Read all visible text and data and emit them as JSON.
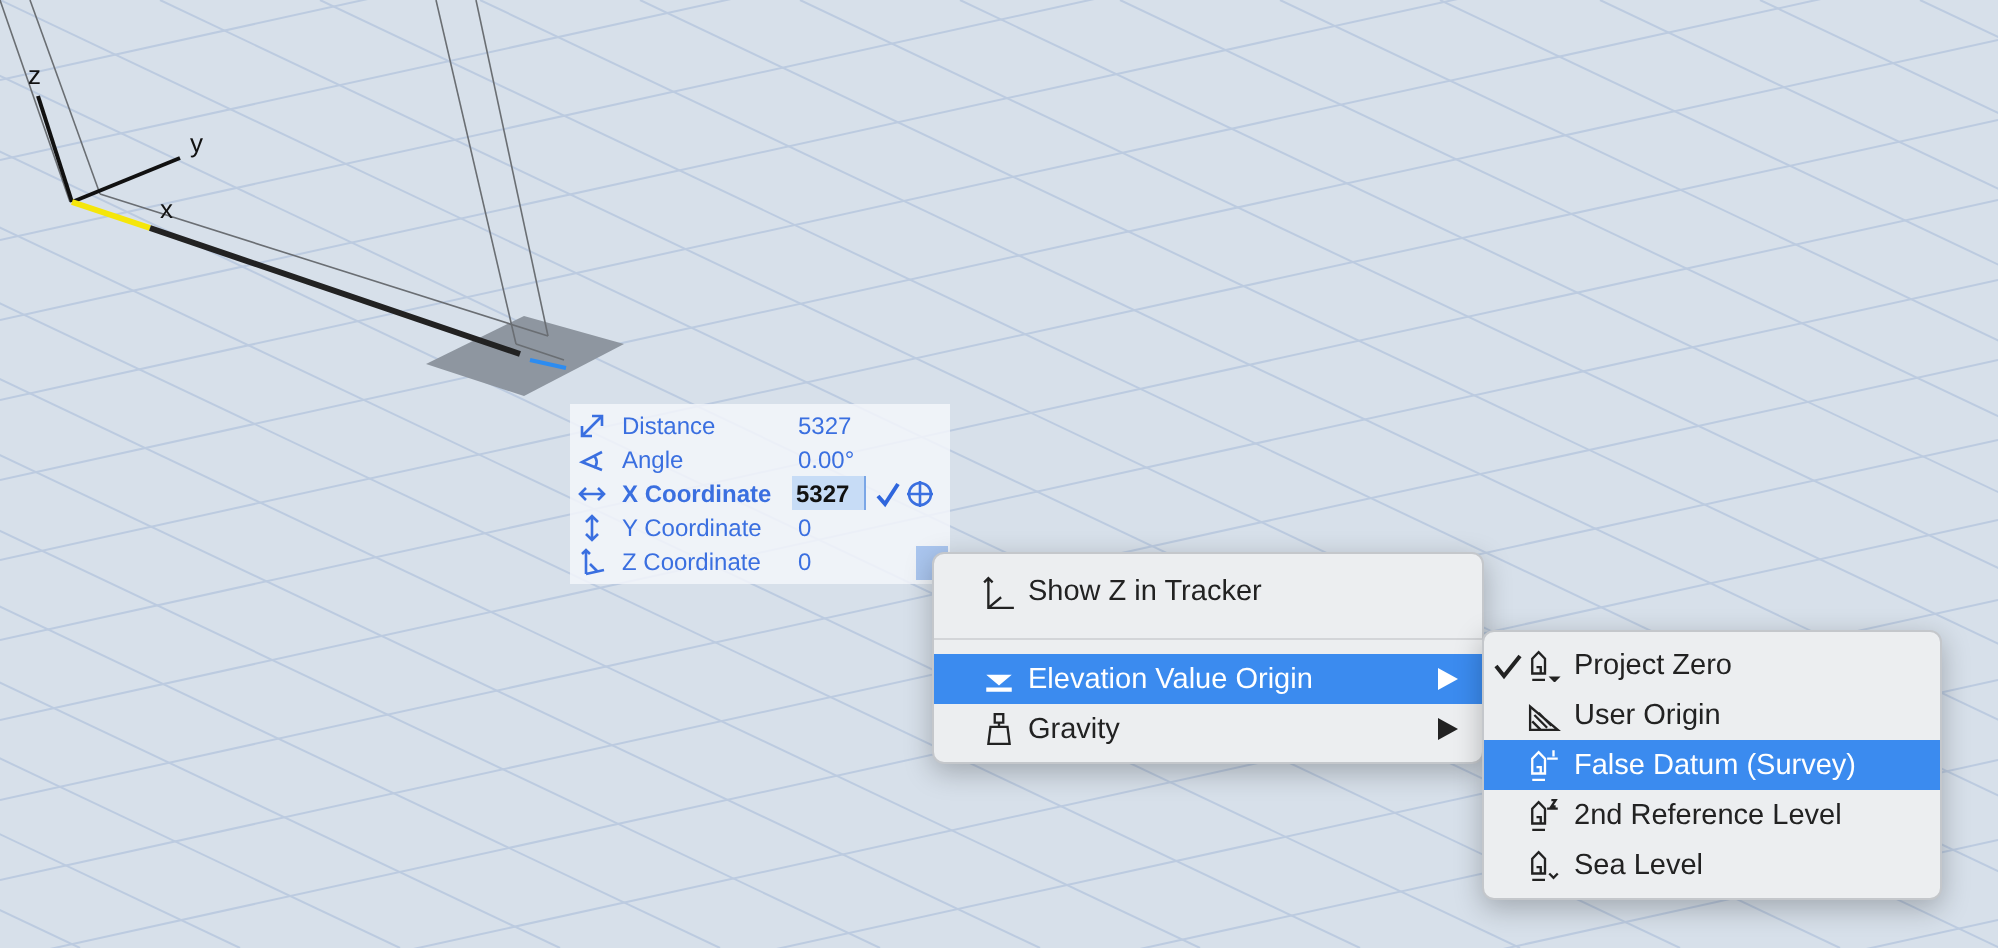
{
  "viewport": {
    "axis_labels": [
      "z",
      "y",
      "x"
    ]
  },
  "tracker": {
    "rows": [
      {
        "label": "Distance",
        "value": "5327",
        "selected": false
      },
      {
        "label": "Angle",
        "value": "0.00°",
        "selected": false
      },
      {
        "label": "X Coordinate",
        "value": "5327",
        "selected": true
      },
      {
        "label": "Y Coordinate",
        "value": "0",
        "selected": false
      },
      {
        "label": "Z Coordinate",
        "value": "0",
        "selected": false
      }
    ]
  },
  "context_menu": {
    "items": [
      {
        "kind": "item",
        "label": "Show Z in Tracker",
        "selected": false
      },
      {
        "kind": "separator"
      },
      {
        "kind": "submenu",
        "label": "Elevation Value Origin",
        "selected": true
      },
      {
        "kind": "submenu",
        "label": "Gravity",
        "selected": false
      }
    ]
  },
  "submenu": {
    "items": [
      {
        "label": "Project Zero",
        "checked": true,
        "selected": false
      },
      {
        "label": "User Origin",
        "checked": false,
        "selected": false
      },
      {
        "label": "False Datum (Survey)",
        "checked": false,
        "selected": true
      },
      {
        "label": "2nd Reference Level",
        "checked": false,
        "selected": false
      },
      {
        "label": "Sea Level",
        "checked": false,
        "selected": false
      }
    ]
  }
}
